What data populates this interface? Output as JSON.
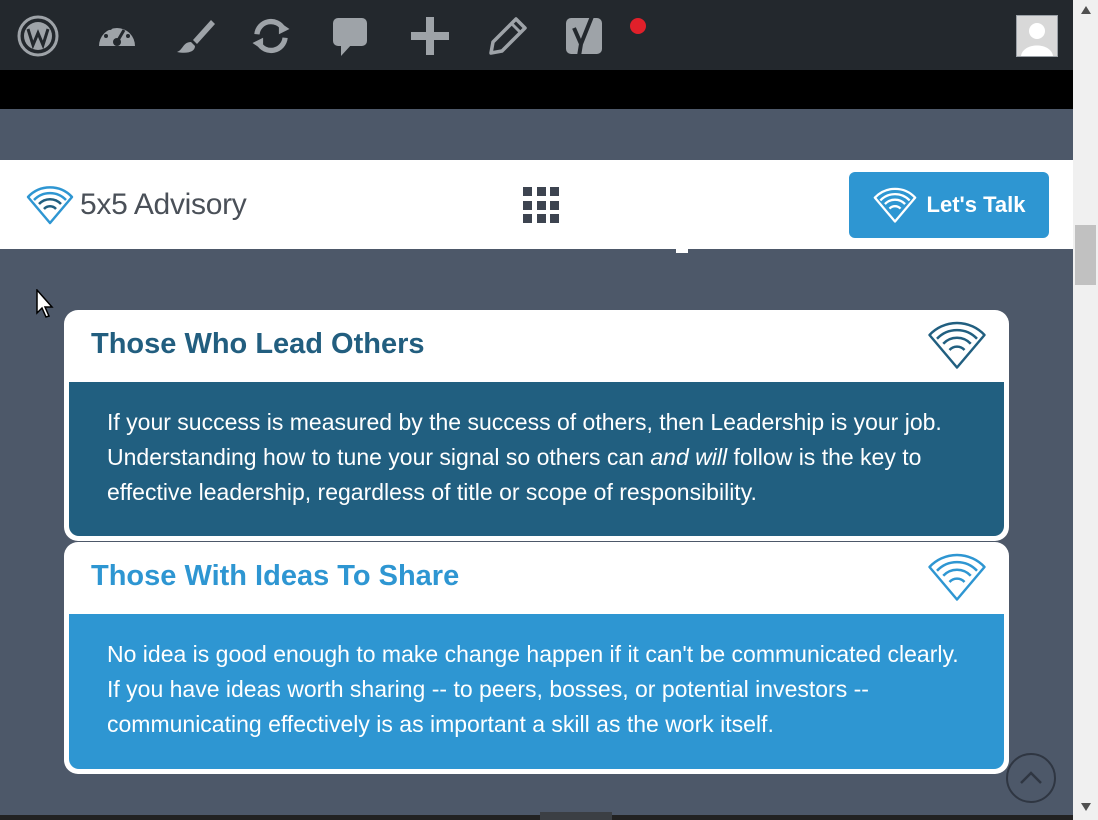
{
  "adminbar": {
    "icons": [
      "wordpress-icon",
      "dashboard-icon",
      "customize-icon",
      "updates-icon",
      "comments-icon",
      "new-icon",
      "edit-icon",
      "yoast-icon"
    ],
    "notification": true
  },
  "header": {
    "logo_text": "5x5 Advisory",
    "cta_label": "Let's Talk",
    "brand_color": "#2e96d2"
  },
  "cards": [
    {
      "title": "Those Who Lead Others",
      "body_before": "If your success is measured by the success of others, then Leadership is your job. Understanding how to tune your signal so others can ",
      "body_em": "and will",
      "body_after": " follow is the key to effective leadership, regardless of title or scope of responsibility.",
      "color": "#215f80"
    },
    {
      "title": "Those With Ideas To Share",
      "body": "No idea is good enough to make change happen if it can't be communicated clearly. If you have ideas worth sharing -- to peers, bosses, or potential investors -- communicating effectively is as important a skill as the work itself.",
      "color": "#2e96d2"
    }
  ]
}
